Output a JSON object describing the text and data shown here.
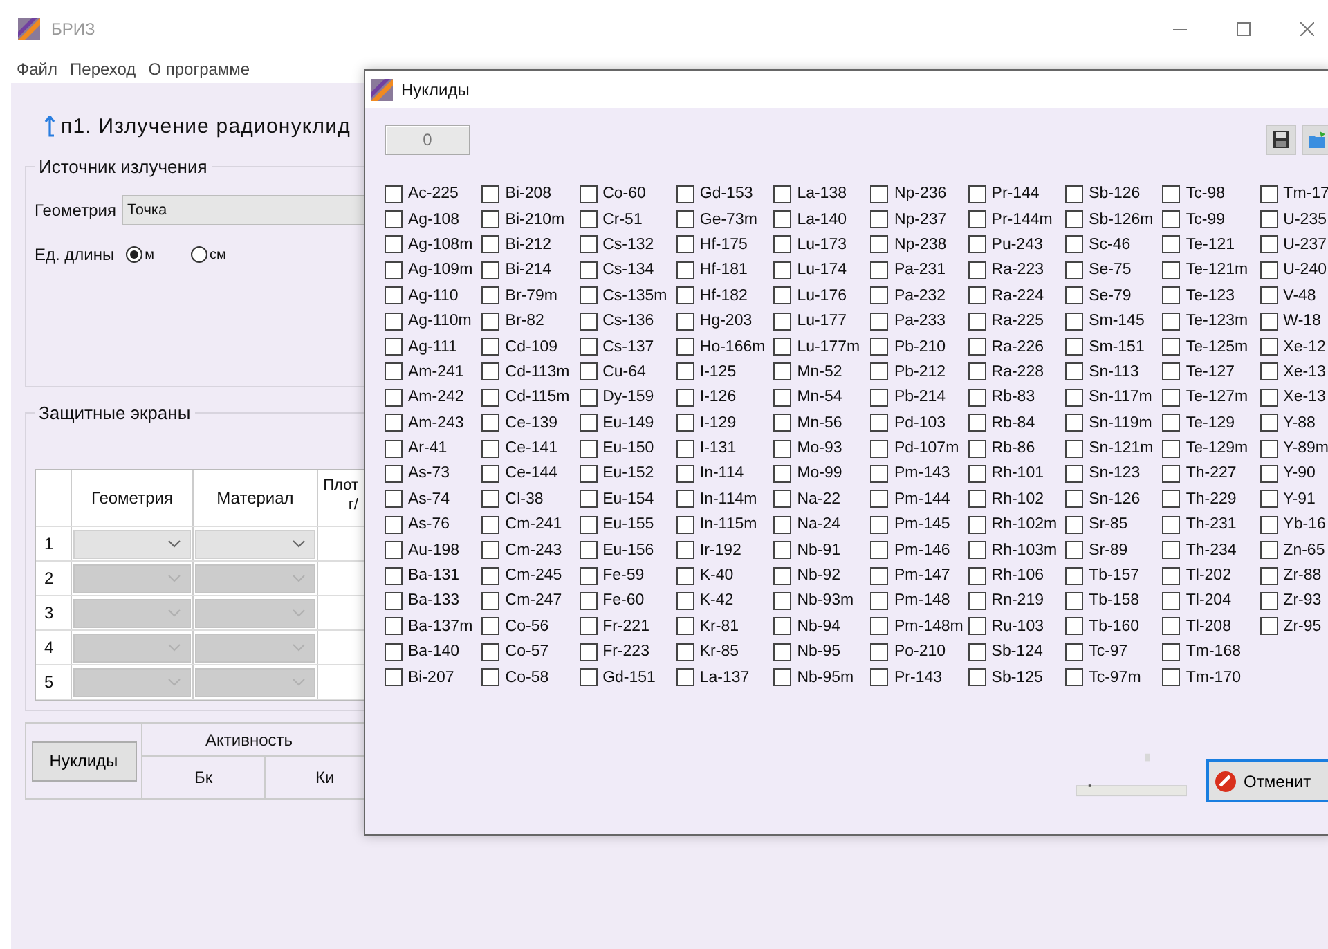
{
  "window": {
    "title": "БРИЗ"
  },
  "menu": [
    "Файл",
    "Переход",
    "О программе"
  ],
  "heading": "п1. Излучение радионуклид",
  "source_group": {
    "title": "Источник излучения",
    "geometry_label": "Геометрия",
    "geometry_value": "Точка",
    "units_label": "Ед. длины",
    "units": [
      {
        "label": "м",
        "selected": true
      },
      {
        "label": "см",
        "selected": false
      }
    ]
  },
  "shields_group": {
    "title": "Защитные экраны",
    "columns": [
      "Геометрия",
      "Материал",
      "Плот г/"
    ],
    "rows": [
      {
        "number": "1",
        "disabled": false
      },
      {
        "number": "2",
        "disabled": true
      },
      {
        "number": "3",
        "disabled": true
      },
      {
        "number": "4",
        "disabled": true
      },
      {
        "number": "5",
        "disabled": true
      }
    ]
  },
  "activity": {
    "button": "Нуклиды",
    "header": "Активность",
    "columns": [
      "Бк",
      "Ки"
    ]
  },
  "dialog": {
    "title": "Нуклиды",
    "count": "0",
    "cancel_button": "Отменит",
    "nuclide_columns": [
      [
        {
          "label": "Ac-225",
          "checked": false
        },
        {
          "label": "Ag-108",
          "checked": false
        },
        {
          "label": "Ag-108m",
          "checked": false
        },
        {
          "label": "Ag-109m",
          "checked": false
        },
        {
          "label": "Ag-110",
          "checked": false
        },
        {
          "label": "Ag-110m",
          "checked": false
        },
        {
          "label": "Ag-111",
          "checked": false
        },
        {
          "label": "Am-241",
          "checked": false
        },
        {
          "label": "Am-242",
          "checked": false
        },
        {
          "label": "Am-243",
          "checked": false
        },
        {
          "label": "Ar-41",
          "checked": false
        },
        {
          "label": "As-73",
          "checked": false
        },
        {
          "label": "As-74",
          "checked": false
        },
        {
          "label": "As-76",
          "checked": false
        },
        {
          "label": "Au-198",
          "checked": false
        },
        {
          "label": "Ba-131",
          "checked": false
        },
        {
          "label": "Ba-133",
          "checked": false
        },
        {
          "label": "Ba-137m",
          "checked": false
        },
        {
          "label": "Ba-140",
          "checked": false
        },
        {
          "label": "Bi-207",
          "checked": false
        }
      ],
      [
        {
          "label": "Bi-208",
          "checked": false
        },
        {
          "label": "Bi-210m",
          "checked": false
        },
        {
          "label": "Bi-212",
          "checked": false
        },
        {
          "label": "Bi-214",
          "checked": false
        },
        {
          "label": "Br-79m",
          "checked": false
        },
        {
          "label": "Br-82",
          "checked": false
        },
        {
          "label": "Cd-109",
          "checked": false
        },
        {
          "label": "Cd-113m",
          "checked": false
        },
        {
          "label": "Cd-115m",
          "checked": false
        },
        {
          "label": "Ce-139",
          "checked": false
        },
        {
          "label": "Ce-141",
          "checked": false
        },
        {
          "label": "Ce-144",
          "checked": false
        },
        {
          "label": "Cl-38",
          "checked": false
        },
        {
          "label": "Cm-241",
          "checked": false
        },
        {
          "label": "Cm-243",
          "checked": false
        },
        {
          "label": "Cm-245",
          "checked": false
        },
        {
          "label": "Cm-247",
          "checked": false
        },
        {
          "label": "Co-56",
          "checked": false
        },
        {
          "label": "Co-57",
          "checked": false
        },
        {
          "label": "Co-58",
          "checked": false
        }
      ],
      [
        {
          "label": "Co-60",
          "checked": false
        },
        {
          "label": "Cr-51",
          "checked": false
        },
        {
          "label": "Cs-132",
          "checked": false
        },
        {
          "label": "Cs-134",
          "checked": false
        },
        {
          "label": "Cs-135m",
          "checked": false
        },
        {
          "label": "Cs-136",
          "checked": false
        },
        {
          "label": "Cs-137",
          "checked": false
        },
        {
          "label": "Cu-64",
          "checked": false
        },
        {
          "label": "Dy-159",
          "checked": false
        },
        {
          "label": "Eu-149",
          "checked": false
        },
        {
          "label": "Eu-150",
          "checked": false
        },
        {
          "label": "Eu-152",
          "checked": false
        },
        {
          "label": "Eu-154",
          "checked": false
        },
        {
          "label": "Eu-155",
          "checked": false
        },
        {
          "label": "Eu-156",
          "checked": false
        },
        {
          "label": "Fe-59",
          "checked": false
        },
        {
          "label": "Fe-60",
          "checked": false
        },
        {
          "label": "Fr-221",
          "checked": false
        },
        {
          "label": "Fr-223",
          "checked": false
        },
        {
          "label": "Gd-151",
          "checked": false
        }
      ],
      [
        {
          "label": "Gd-153",
          "checked": false
        },
        {
          "label": "Ge-73m",
          "checked": false
        },
        {
          "label": "Hf-175",
          "checked": false
        },
        {
          "label": "Hf-181",
          "checked": false
        },
        {
          "label": "Hf-182",
          "checked": false
        },
        {
          "label": "Hg-203",
          "checked": false
        },
        {
          "label": "Ho-166m",
          "checked": false
        },
        {
          "label": "I-125",
          "checked": false
        },
        {
          "label": "I-126",
          "checked": false
        },
        {
          "label": "I-129",
          "checked": false
        },
        {
          "label": "I-131",
          "checked": false
        },
        {
          "label": "In-114",
          "checked": false
        },
        {
          "label": "In-114m",
          "checked": false
        },
        {
          "label": "In-115m",
          "checked": false
        },
        {
          "label": "Ir-192",
          "checked": false
        },
        {
          "label": "K-40",
          "checked": false
        },
        {
          "label": "K-42",
          "checked": false
        },
        {
          "label": "Kr-81",
          "checked": false
        },
        {
          "label": "Kr-85",
          "checked": false
        },
        {
          "label": "La-137",
          "checked": false
        }
      ],
      [
        {
          "label": "La-138",
          "checked": false
        },
        {
          "label": "La-140",
          "checked": false
        },
        {
          "label": "Lu-173",
          "checked": false
        },
        {
          "label": "Lu-174",
          "checked": false
        },
        {
          "label": "Lu-176",
          "checked": false
        },
        {
          "label": "Lu-177",
          "checked": false
        },
        {
          "label": "Lu-177m",
          "checked": false
        },
        {
          "label": "Mn-52",
          "checked": false
        },
        {
          "label": "Mn-54",
          "checked": false
        },
        {
          "label": "Mn-56",
          "checked": false
        },
        {
          "label": "Mo-93",
          "checked": false
        },
        {
          "label": "Mo-99",
          "checked": false
        },
        {
          "label": "Na-22",
          "checked": false
        },
        {
          "label": "Na-24",
          "checked": false
        },
        {
          "label": "Nb-91",
          "checked": false
        },
        {
          "label": "Nb-92",
          "checked": false
        },
        {
          "label": "Nb-93m",
          "checked": false
        },
        {
          "label": "Nb-94",
          "checked": false
        },
        {
          "label": "Nb-95",
          "checked": false
        },
        {
          "label": "Nb-95m",
          "checked": false
        }
      ],
      [
        {
          "label": "Np-236",
          "checked": false
        },
        {
          "label": "Np-237",
          "checked": false
        },
        {
          "label": "Np-238",
          "checked": false
        },
        {
          "label": "Pa-231",
          "checked": false
        },
        {
          "label": "Pa-232",
          "checked": false
        },
        {
          "label": "Pa-233",
          "checked": false
        },
        {
          "label": "Pb-210",
          "checked": false
        },
        {
          "label": "Pb-212",
          "checked": false
        },
        {
          "label": "Pb-214",
          "checked": false
        },
        {
          "label": "Pd-103",
          "checked": false
        },
        {
          "label": "Pd-107m",
          "checked": false
        },
        {
          "label": "Pm-143",
          "checked": false
        },
        {
          "label": "Pm-144",
          "checked": false
        },
        {
          "label": "Pm-145",
          "checked": false
        },
        {
          "label": "Pm-146",
          "checked": false
        },
        {
          "label": "Pm-147",
          "checked": false
        },
        {
          "label": "Pm-148",
          "checked": false
        },
        {
          "label": "Pm-148m",
          "checked": false
        },
        {
          "label": "Po-210",
          "checked": false
        },
        {
          "label": "Pr-143",
          "checked": false
        }
      ],
      [
        {
          "label": "Pr-144",
          "checked": false
        },
        {
          "label": "Pr-144m",
          "checked": false
        },
        {
          "label": "Pu-243",
          "checked": false
        },
        {
          "label": "Ra-223",
          "checked": false
        },
        {
          "label": "Ra-224",
          "checked": false
        },
        {
          "label": "Ra-225",
          "checked": false
        },
        {
          "label": "Ra-226",
          "checked": false
        },
        {
          "label": "Ra-228",
          "checked": false
        },
        {
          "label": "Rb-83",
          "checked": false
        },
        {
          "label": "Rb-84",
          "checked": false
        },
        {
          "label": "Rb-86",
          "checked": false
        },
        {
          "label": "Rh-101",
          "checked": false
        },
        {
          "label": "Rh-102",
          "checked": false
        },
        {
          "label": "Rh-102m",
          "checked": false
        },
        {
          "label": "Rh-103m",
          "checked": false
        },
        {
          "label": "Rh-106",
          "checked": false
        },
        {
          "label": "Rn-219",
          "checked": false
        },
        {
          "label": "Ru-103",
          "checked": false
        },
        {
          "label": "Sb-124",
          "checked": false
        },
        {
          "label": "Sb-125",
          "checked": false
        }
      ],
      [
        {
          "label": "Sb-126",
          "checked": false
        },
        {
          "label": "Sb-126m",
          "checked": false
        },
        {
          "label": "Sc-46",
          "checked": false
        },
        {
          "label": "Se-75",
          "checked": false
        },
        {
          "label": "Se-79",
          "checked": false
        },
        {
          "label": "Sm-145",
          "checked": false
        },
        {
          "label": "Sm-151",
          "checked": false
        },
        {
          "label": "Sn-113",
          "checked": false
        },
        {
          "label": "Sn-117m",
          "checked": false
        },
        {
          "label": "Sn-119m",
          "checked": false
        },
        {
          "label": "Sn-121m",
          "checked": false
        },
        {
          "label": "Sn-123",
          "checked": false
        },
        {
          "label": "Sn-126",
          "checked": false
        },
        {
          "label": "Sr-85",
          "checked": false
        },
        {
          "label": "Sr-89",
          "checked": false
        },
        {
          "label": "Tb-157",
          "checked": false
        },
        {
          "label": "Tb-158",
          "checked": false
        },
        {
          "label": "Tb-160",
          "checked": false
        },
        {
          "label": "Tc-97",
          "checked": false
        },
        {
          "label": "Tc-97m",
          "checked": false
        }
      ],
      [
        {
          "label": "Tc-98",
          "checked": false
        },
        {
          "label": "Tc-99",
          "checked": false
        },
        {
          "label": "Te-121",
          "checked": false
        },
        {
          "label": "Te-121m",
          "checked": false
        },
        {
          "label": "Te-123",
          "checked": false
        },
        {
          "label": "Te-123m",
          "checked": false
        },
        {
          "label": "Te-125m",
          "checked": false
        },
        {
          "label": "Te-127",
          "checked": false
        },
        {
          "label": "Te-127m",
          "checked": false
        },
        {
          "label": "Te-129",
          "checked": false
        },
        {
          "label": "Te-129m",
          "checked": false
        },
        {
          "label": "Th-227",
          "checked": false
        },
        {
          "label": "Th-229",
          "checked": false
        },
        {
          "label": "Th-231",
          "checked": false
        },
        {
          "label": "Th-234",
          "checked": false
        },
        {
          "label": "Tl-202",
          "checked": false
        },
        {
          "label": "Tl-204",
          "checked": false
        },
        {
          "label": "Tl-208",
          "checked": false
        },
        {
          "label": "Tm-168",
          "checked": false
        },
        {
          "label": "Tm-170",
          "checked": false
        }
      ],
      [
        {
          "label": "Tm-17",
          "checked": false
        },
        {
          "label": "U-235",
          "checked": false
        },
        {
          "label": "U-237",
          "checked": false
        },
        {
          "label": "U-240",
          "checked": false
        },
        {
          "label": "V-48",
          "checked": false
        },
        {
          "label": "W-18",
          "checked": false
        },
        {
          "label": "Xe-12",
          "checked": false
        },
        {
          "label": "Xe-13",
          "checked": false
        },
        {
          "label": "Xe-13",
          "checked": false
        },
        {
          "label": "Y-88",
          "checked": false
        },
        {
          "label": "Y-89m",
          "checked": false
        },
        {
          "label": "Y-90",
          "checked": false
        },
        {
          "label": "Y-91",
          "checked": false
        },
        {
          "label": "Yb-16",
          "checked": false
        },
        {
          "label": "Zn-65",
          "checked": false
        },
        {
          "label": "Zr-88",
          "checked": false
        },
        {
          "label": "Zr-93",
          "checked": false
        },
        {
          "label": "Zr-95",
          "checked": false
        }
      ]
    ]
  }
}
